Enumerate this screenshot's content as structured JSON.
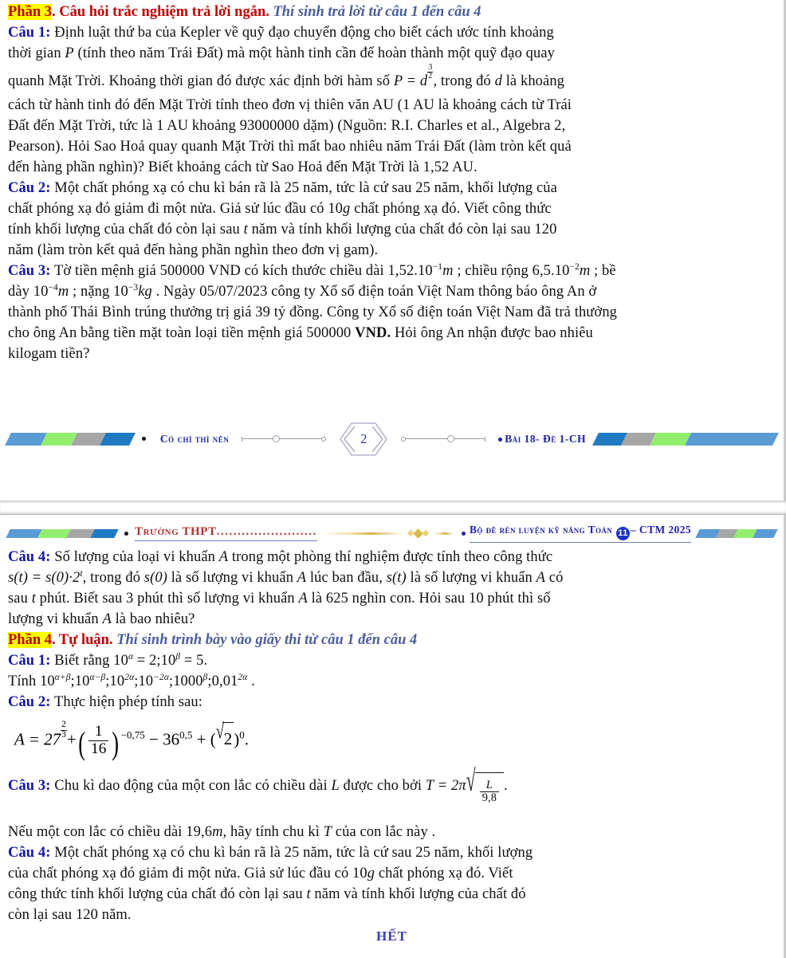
{
  "document": {
    "title": "Bộ đề rèn luyện kỹ năng Toán 11 - CTM 2025",
    "colors": {
      "highlight": "#ffff00",
      "red": "#c00000",
      "blue_heading": "#1414aa",
      "italic_blue": "#4a5c9b",
      "school_red": "#b03030",
      "badge_blue": "#1a35c8",
      "band_blue": "#5b9bd5",
      "band_green": "#92ef6e",
      "band_gray": "#a6a6a6",
      "band_darkblue": "#1f7ac4"
    }
  },
  "page1": {
    "section3": {
      "label": "Phần 3",
      "dot": ".",
      "title": " Câu hỏi trắc nghiệm trả lời ngắn.",
      "instruction": "Thí sinh trả lời từ câu 1 đến câu 4"
    },
    "q1": {
      "label": "Câu 1:",
      "l1": " Định luật thứ ba của Kepler về quỹ đạo chuyển động cho biết cách ước tính khoảng",
      "l2a": "thời gian ",
      "l2_var": "P",
      "l2b": " (tính theo năm Trái Đất) mà một hành tinh cần để hoàn thành một quỹ đạo quay",
      "l3a": "quanh Mặt Trời. Khoảng thời gian đó được xác định bởi hàm số ",
      "formula_P": "P = d",
      "exp_num": "3",
      "exp_den": "2",
      "l3b": ", trong đó ",
      "l3_var": "d",
      "l3c": " là khoảng",
      "l4": "cách từ hành tinh đó đến Mặt Trời tính theo đơn vị thiên văn AU (1 AU là khoảng cách từ Trái",
      "l5": "Đất đến Mặt Trời, tức là 1 AU khoảng 93000000 dặm) (Nguồn: R.I. Charles et al., Algebra 2,",
      "l6": "Pearson). Hỏi Sao Hoả quay quanh Mặt Trời thì mất bao nhiêu năm Trái Đất (làm tròn kết quả",
      "l7": "đến hàng phần nghìn)? Biết khoảng cách từ Sao Hoả đến Mặt Trời là 1,52 AU."
    },
    "q2": {
      "label": "Câu 2:",
      "l1": " Một chất phóng xạ có chu kì bán rã là 25 năm, tức là cứ sau 25 năm, khối lượng của",
      "l2a": "chất phóng xạ đó giảm đi một nửa. Giả sử lúc đầu có 10",
      "l2_unit": "g",
      "l2b": " chất phóng xạ đó. Viết công thức",
      "l3a": "tính khối lượng của chất đó còn lại sau ",
      "l3_var": "t",
      "l3b": " năm và tính khối lượng của chất đó còn lại sau 120",
      "l4": "năm (làm tròn kết quả đến hàng phần nghìn theo đơn vị gam)."
    },
    "q3": {
      "label": "Câu 3:",
      "l1a": " Tờ tiền mệnh giá 500000",
      "l1b": "VND có kích thước chiều dài 1,52.10",
      "l1_exp1": "−1",
      "l1_unit1": "m",
      "l1c": " ; chiều rộng 6,5.10",
      "l1_exp2": "−2",
      "l1_unit2": "m",
      "l1d": " ; bề",
      "l2a": "dày 10",
      "l2_exp1": "−4",
      "l2_unit1": "m",
      "l2b": " ; nặng 10",
      "l2_exp2": "−3",
      "l2_unit2": "kg",
      "l2c": " . Ngày 05/07/2023 công ty Xổ số điện toán Việt Nam thông báo ông An ở",
      "l3a": "thành phố Thái Bình trúng thưởng trị giá 39",
      "l3b": " tỷ đồng. Công ty Xổ số điện toán Việt Nam đã trả thưởng",
      "l4a": "cho ông An bằng tiền mặt toàn loại tiền mệnh giá 500000",
      "l4b": "VND.",
      "l4c": " Hỏi ông An nhận được bao nhiêu",
      "l5": "kilogam tiền?"
    },
    "footer": {
      "left_text": "Có chí thì nên",
      "page_number": "2",
      "right_text": "Bài 18- Đề 1-CH"
    }
  },
  "page2": {
    "header": {
      "school_label": "Trường THPT",
      "school_dots": "........................",
      "series_label": "Bộ đề rèn luyện kỹ năng Toán",
      "series_badge": "11",
      "series_suffix": "– CTM 2025"
    },
    "q4": {
      "label": "Câu 4:",
      "l1a": " Số lượng của loại vi khuẩn ",
      "l1_var": "A",
      "l1b": " trong một phòng thí nghiệm được tính theo công thức",
      "formula": "s(t) = s(0)·2",
      "formula_exp": "t",
      "l2a": ", trong đó ",
      "l2_s0": "s(0)",
      "l2b": " là số lượng vi khuẩn ",
      "l2_var1": "A",
      "l2c": " lúc ban đầu, ",
      "l2_st": "s(t)",
      "l2d": " là số lượng vi khuẩn ",
      "l2_var2": "A",
      "l2e": " có",
      "l3a": "sau ",
      "l3_var": "t",
      "l3b": " phút. Biết sau 3 phút thì số lượng vi khuẩn ",
      "l3_var2": "A",
      "l3c": " là 625 nghìn con. Hỏi sau 10 phút thì số",
      "l4a": "lượng vi khuẩn ",
      "l4_var": "A",
      "l4b": " là bao nhiêu?"
    },
    "section4": {
      "label": "Phần 4",
      "dot": ".",
      "title": " Tự luận.",
      "instruction": "Thí sinh trình bày vào giấy thi từ câu 1 đến câu 4"
    },
    "q1": {
      "label": "Câu 1:",
      "l1a": " Biết rằng 10",
      "l1_exp1": "α",
      "l1b": " = 2;10",
      "l1_exp2": "β",
      "l1c": " = 5.",
      "l2a": "Tính 10",
      "l2_e1": "α+β",
      "l2b": ";10",
      "l2_e2": "α−β",
      "l2c": ";10",
      "l2_e3": "2α",
      "l2d": ";10",
      "l2_e4": "−2α",
      "l2e": ";1000",
      "l2_e5": "β",
      "l2f": ";0,01",
      "l2_e6": "2α",
      "l2g": " ."
    },
    "q2": {
      "label": "Câu 2:",
      "text": " Thực hiện phép tính sau:",
      "formula": {
        "lhs": "A = 27",
        "exp1_num": "2",
        "exp1_den": "3",
        "plus": "+",
        "frac_num": "1",
        "frac_den": "16",
        "exp2": "−0,75",
        "minus": "− 36",
        "exp3": "0,5",
        "plus2": "+ (",
        "radicand": "2",
        "close": ")",
        "exp4": "0",
        "period": "."
      }
    },
    "q3": {
      "label": "Câu 3:",
      "l1a": " Chu kì dao động  của một con lắc có chiều dài ",
      "l1_var": "L",
      "l1b": "  được cho bởi ",
      "formula_lhs": "T = 2π",
      "formula_num": "L",
      "formula_den": "9,8",
      "l1c": ".",
      "l2a": "Nếu một con lắc có chiều dài 19,6",
      "l2_unit": "m",
      "l2b": ", hãy tính chu kì ",
      "l2_var": "T",
      "l2c": " của con lắc này ."
    },
    "q4b": {
      "label": "Câu 4:",
      "l1": " Một chất phóng xạ có chu kì bán rã là 25 năm, tức là cứ sau 25 năm, khối lượng",
      "l2a": "của chất phóng xạ đó giảm đi một nửa. Giả sử lúc đầu có 10",
      "l2_unit": "g",
      "l2b": " chất phóng xạ đó. Viết",
      "l3a": "công thức tính khối lượng của chất đó còn lại sau ",
      "l3_var": "t",
      "l3b": " năm và tính khối lượng của chất đó",
      "l4": "còn lại sau 120 năm."
    },
    "end_mark": "HẾT"
  }
}
